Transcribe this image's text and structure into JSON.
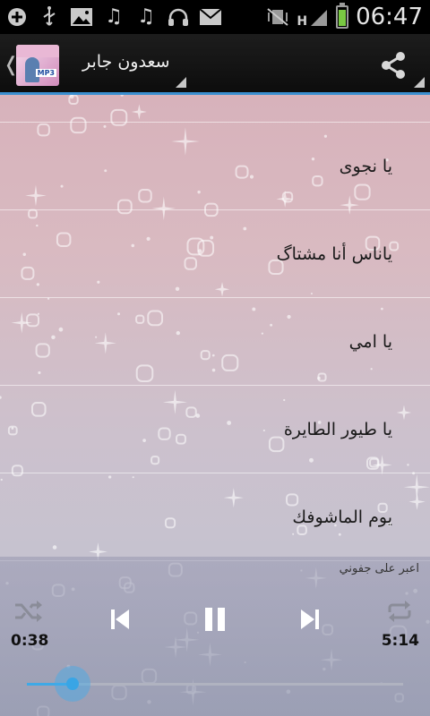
{
  "status_bar": {
    "time": "06:47",
    "network_label": "H",
    "battery_level": 0.8,
    "icons": [
      "add-icon",
      "usb-icon",
      "image-icon",
      "music-note-icon",
      "music-note-icon",
      "headphones-icon",
      "mail-icon",
      "vibrate-muted-icon",
      "signal-icon",
      "battery-icon"
    ]
  },
  "action_bar": {
    "title": "سعدون جابر",
    "app_thumb_label": "MP3"
  },
  "songs": [
    {
      "title": "يا نجوى"
    },
    {
      "title": "ياناس أنا مشتاگ"
    },
    {
      "title": "يا امي"
    },
    {
      "title": "يا طيور الطايرة"
    },
    {
      "title": "يوم الماشوفك"
    }
  ],
  "player": {
    "now_playing": "اعبر على جفوني",
    "elapsed": "0:38",
    "duration": "5:14",
    "progress": 0.121
  },
  "colors": {
    "accent": "#3fa9e6",
    "action_bar_underline": "#3a8fd0",
    "battery_green": "#7ac943"
  }
}
